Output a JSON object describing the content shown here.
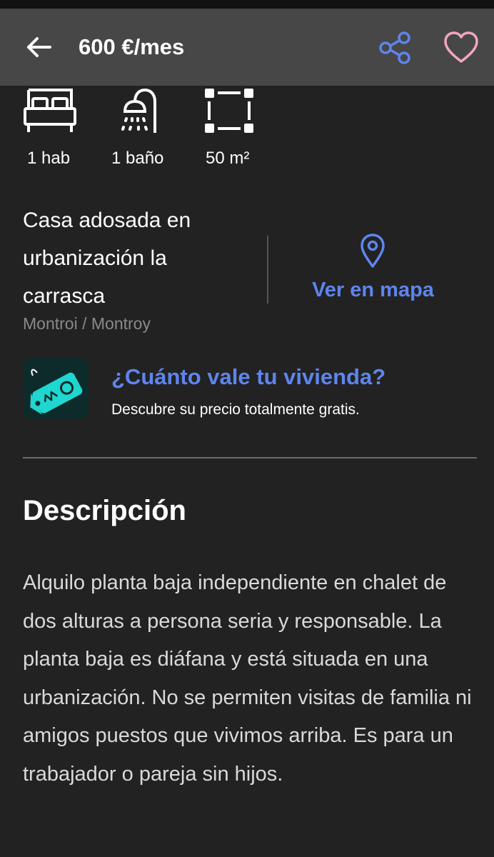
{
  "header": {
    "title": "600 €/mes",
    "back_icon": "arrow-left-icon",
    "share_icon": "share-icon",
    "favorite_icon": "heart-outline-icon"
  },
  "features": [
    {
      "icon": "bed-icon",
      "label": "1 hab"
    },
    {
      "icon": "shower-icon",
      "label": "1 baño"
    },
    {
      "icon": "area-icon",
      "label": "50 m²"
    }
  ],
  "listing": {
    "address": "Casa adosada en urbanización la carrasca",
    "location": "Montroi / Montroy"
  },
  "map": {
    "icon": "map-pin-icon",
    "label": "Ver en mapa"
  },
  "valuation": {
    "icon": "price-tag-icon",
    "title": "¿Cuánto vale tu vivienda?",
    "subtitle": "Descubre su precio totalmente gratis."
  },
  "description": {
    "title": "Descripción",
    "body": "Alquilo planta baja independiente en chalet de dos alturas a persona seria y responsable. La planta baja es diáfana y está situada en una urbanización. No se permiten visitas de familia ni amigos puestos que vivimos arriba. Es para un trabajador o pareja sin hijos."
  },
  "colors": {
    "background": "#222222",
    "app_bar": "#474747",
    "accent_blue": "#5e85ee",
    "favorite_pink": "#f2a6c2",
    "muted_text": "#8a8a8a"
  }
}
